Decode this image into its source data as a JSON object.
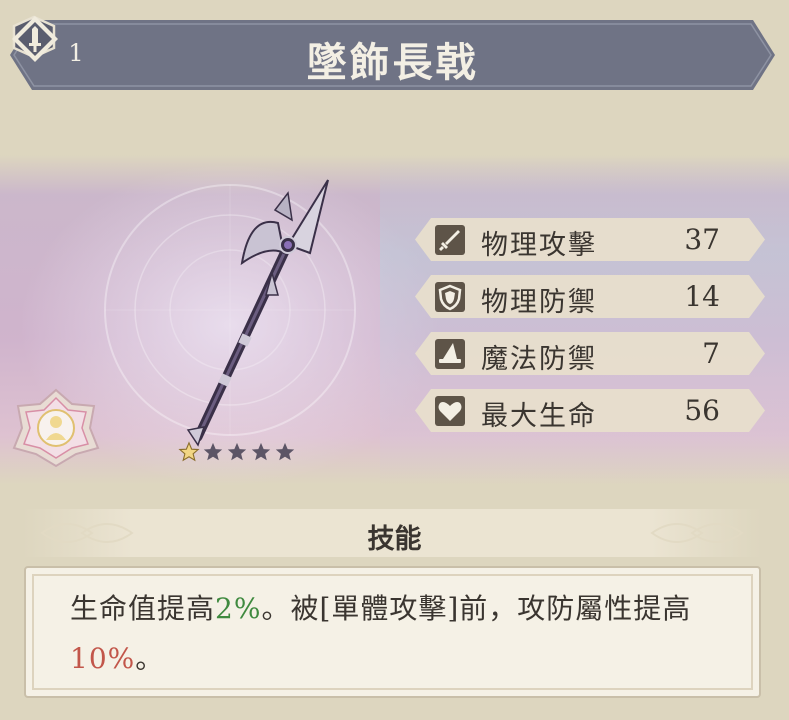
{
  "item": {
    "name": "墜飾長戟",
    "level": "1",
    "type_icon": "sword-diamond-icon",
    "rarity_stars_filled": 1,
    "rarity_stars_total": 5
  },
  "stats": [
    {
      "icon": "sword-icon",
      "label": "物理攻擊",
      "value": "37"
    },
    {
      "icon": "shield-icon",
      "label": "物理防禦",
      "value": "14"
    },
    {
      "icon": "wizard-hat-icon",
      "label": "魔法防禦",
      "value": "7"
    },
    {
      "icon": "heart-icon",
      "label": "最大生命",
      "value": "56"
    }
  ],
  "skills": {
    "header": "技能",
    "description": {
      "part1": "生命值提高",
      "highlight1": "2%",
      "part2": "。被[單體攻擊]前，攻防屬性提高",
      "highlight2": "10%",
      "part3": "。"
    }
  },
  "colors": {
    "banner": "#6f7385",
    "stat_bg": "#e8e0cc",
    "icon_bg": "#5e5448",
    "highlight_green": "#3f8a3f",
    "highlight_red": "#c2564a"
  }
}
